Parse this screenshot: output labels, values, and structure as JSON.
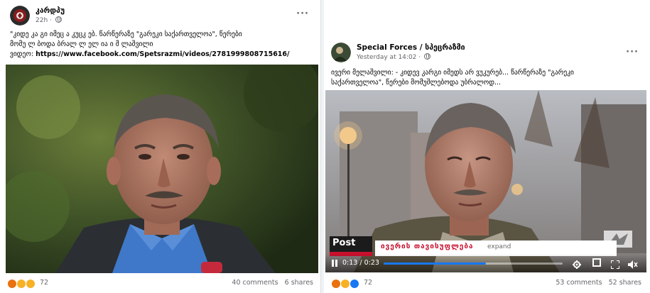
{
  "left_post": {
    "page_name": "კარდპუ",
    "timestamp": "22h",
    "caption_line1": "\"კიდე   კა გი  იმეც   ა  კუცკ  ებ. წარწერაზე \"გარეკი საქართველოა\", წერები",
    "caption_line2": "მომუ  ლ ბოდა  ბრალ  ლ     ელ   ია   ი  მ  ლაშვილი",
    "video_label": "ვიდეო:",
    "video_url": "https://www.facebook.com/Spetsrazmi/videos/2781999808715616/",
    "reactions_count": "72",
    "comments": "40 comments",
    "shares": "6 shares",
    "reactions": [
      "angry",
      "wow",
      "sad"
    ]
  },
  "right_post": {
    "page_name": "Special Forces / სპეცრაზმი",
    "timestamp": "Yesterday at 14:02",
    "caption_line1": "ივერი მელაშვილი: - კიდევ კარგი იმედს არ ვუკურებ... წარწერაზე \"გარეკი",
    "caption_line2": "საქართველოა\", წერები მომუშლებოდა უბრალოდ...",
    "lower_third_logo": "Post",
    "lower_third_name": "ივერის თავისუფლება",
    "lower_third_suffix": "expand",
    "video_time": "0:13 / 0:23",
    "video_progress": 0.57,
    "reactions_count": "72",
    "comments": "53 comments",
    "shares": "52 shares",
    "reactions": [
      "angry",
      "wow",
      "like"
    ]
  },
  "icons": {
    "more": "more-icon",
    "globe": "globe-icon",
    "play_pause": "pause-icon",
    "settings": "gear-icon",
    "fullscreen": "fullscreen-icon",
    "volume": "volume-icon"
  },
  "colors": {
    "meta_text": "#65676b",
    "progress_fill": "#1877f2",
    "lower_third_bg": "#ffffff"
  }
}
